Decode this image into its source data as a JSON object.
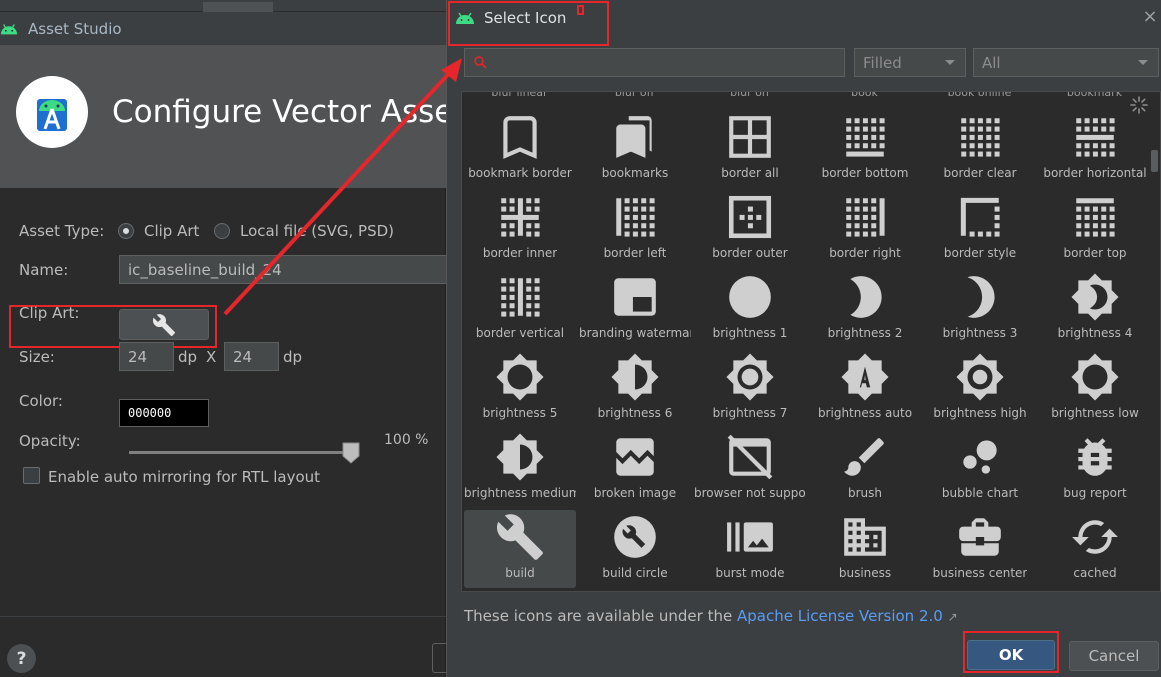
{
  "asset_studio": {
    "window_title": "Asset Studio",
    "heading": "Configure Vector Asset",
    "asset_type_label": "Asset Type:",
    "asset_type_option_clipart": "Clip Art",
    "asset_type_option_local": "Local file (SVG, PSD)",
    "asset_type_selected": "Clip Art",
    "name_label": "Name:",
    "name_value": "ic_baseline_build_24",
    "clipart_label": "Clip Art:",
    "clipart_icon": "wrench-icon",
    "size_label": "Size:",
    "width_value": "24",
    "height_value": "24",
    "unit_dp": "dp",
    "size_separator": "X",
    "color_label": "Color:",
    "color_value": "000000",
    "opacity_label": "Opacity:",
    "opacity_value": "100 %",
    "opacity_level_percent": 100,
    "rtl_label": "Enable auto mirroring for RTL layout",
    "rtl_checked": false,
    "help_label": "?"
  },
  "select_icon": {
    "title": "Select Icon",
    "search_value": "",
    "style_filter": "Filled",
    "category_filter": "All",
    "partial_row": [
      "blur linear",
      "blur off",
      "blur on",
      "book",
      "book online",
      "bookmark"
    ],
    "icons": [
      {
        "name": "bookmark border",
        "icon": "bookmark-border-icon"
      },
      {
        "name": "bookmarks",
        "icon": "bookmarks-icon"
      },
      {
        "name": "border all",
        "icon": "border-all-icon"
      },
      {
        "name": "border bottom",
        "icon": "border-bottom-icon"
      },
      {
        "name": "border clear",
        "icon": "border-clear-icon"
      },
      {
        "name": "border horizontal",
        "icon": "border-horizontal-icon"
      },
      {
        "name": "border inner",
        "icon": "border-inner-icon"
      },
      {
        "name": "border left",
        "icon": "border-left-icon"
      },
      {
        "name": "border outer",
        "icon": "border-outer-icon"
      },
      {
        "name": "border right",
        "icon": "border-right-icon"
      },
      {
        "name": "border style",
        "icon": "border-style-icon"
      },
      {
        "name": "border top",
        "icon": "border-top-icon"
      },
      {
        "name": "border vertical",
        "icon": "border-vertical-icon"
      },
      {
        "name": "branding watermark",
        "icon": "branding-watermark-icon"
      },
      {
        "name": "brightness 1",
        "icon": "brightness-1-icon"
      },
      {
        "name": "brightness 2",
        "icon": "brightness-2-icon"
      },
      {
        "name": "brightness 3",
        "icon": "brightness-3-icon"
      },
      {
        "name": "brightness 4",
        "icon": "brightness-4-icon"
      },
      {
        "name": "brightness 5",
        "icon": "brightness-5-icon"
      },
      {
        "name": "brightness 6",
        "icon": "brightness-6-icon"
      },
      {
        "name": "brightness 7",
        "icon": "brightness-7-icon"
      },
      {
        "name": "brightness auto",
        "icon": "brightness-auto-icon"
      },
      {
        "name": "brightness high",
        "icon": "brightness-high-icon"
      },
      {
        "name": "brightness low",
        "icon": "brightness-low-icon"
      },
      {
        "name": "brightness medium",
        "icon": "brightness-medium-icon"
      },
      {
        "name": "broken image",
        "icon": "broken-image-icon"
      },
      {
        "name": "browser not supported",
        "icon": "browser-not-supported-icon"
      },
      {
        "name": "brush",
        "icon": "brush-icon"
      },
      {
        "name": "bubble chart",
        "icon": "bubble-chart-icon"
      },
      {
        "name": "bug report",
        "icon": "bug-report-icon"
      },
      {
        "name": "build",
        "icon": "wrench-icon"
      },
      {
        "name": "build circle",
        "icon": "build-circle-icon"
      },
      {
        "name": "burst mode",
        "icon": "burst-mode-icon"
      },
      {
        "name": "business",
        "icon": "business-icon"
      },
      {
        "name": "business center",
        "icon": "business-center-icon"
      },
      {
        "name": "cached",
        "icon": "cached-icon"
      }
    ],
    "selected_icon": "build",
    "license_text": "These icons are available under the ",
    "license_link": "Apache License Version 2.0",
    "license_arrow": "↗",
    "ok_label": "OK",
    "cancel_label": "Cancel",
    "close_label": "×"
  },
  "colors": {
    "highlight_red": "#e5262b",
    "link_blue": "#589df6",
    "ok_blue": "#365880",
    "android_green": "#3ddc84"
  }
}
